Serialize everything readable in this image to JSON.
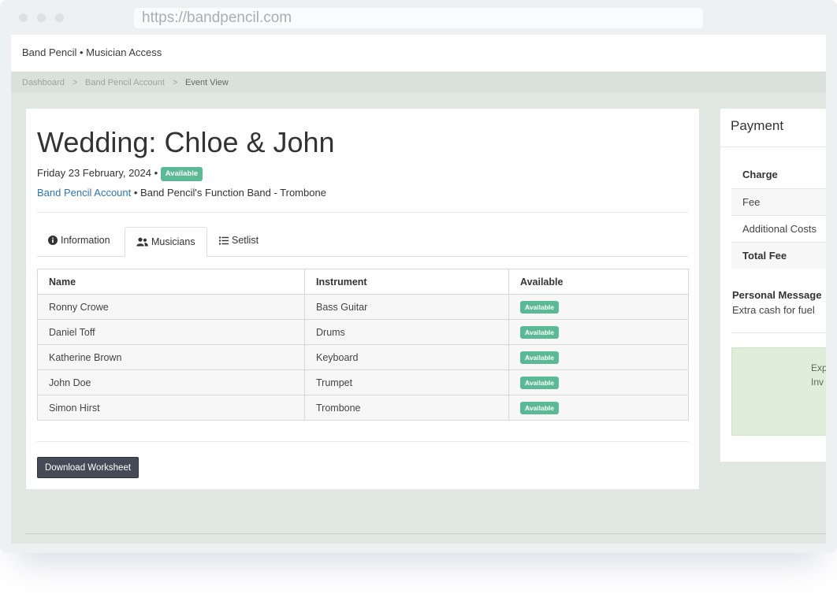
{
  "browser": {
    "url": "https://bandpencil.com"
  },
  "nav": {
    "brand": "Band Pencil • Musician Access"
  },
  "breadcrumb": {
    "items": [
      "Dashboard",
      "Band Pencil Account",
      "Event View"
    ],
    "separator": ">"
  },
  "event": {
    "title": "Wedding: Chloe & John",
    "date": "Friday 23 February, 2024 •",
    "status": "Available",
    "account_link": "Band Pencil Account",
    "band_role": "• Band Pencil's Function Band - Trombone"
  },
  "tabs": [
    {
      "label": "Information",
      "icon": "info-circle-icon"
    },
    {
      "label": "Musicians",
      "icon": "users-icon",
      "active": true
    },
    {
      "label": "Setlist",
      "icon": "list-icon"
    }
  ],
  "musicians_table": {
    "columns": [
      "Name",
      "Instrument",
      "Available"
    ],
    "rows": [
      {
        "name": "Ronny Crowe",
        "instrument": "Bass Guitar",
        "available": "Available"
      },
      {
        "name": "Daniel Toff",
        "instrument": "Drums",
        "available": "Available"
      },
      {
        "name": "Katherine Brown",
        "instrument": "Keyboard",
        "available": "Available"
      },
      {
        "name": "John Doe",
        "instrument": "Trumpet",
        "available": "Available"
      },
      {
        "name": "Simon Hirst",
        "instrument": "Trombone",
        "available": "Available"
      }
    ]
  },
  "actions": {
    "download_worksheet": "Download Worksheet"
  },
  "payment": {
    "title": "Payment",
    "rows": [
      "Charge",
      "Fee",
      "Additional Costs",
      "Total Fee"
    ],
    "personal_message_label": "Personal Message",
    "personal_message": "Extra cash for fuel",
    "notice_lines": [
      "Exp",
      "Inv"
    ]
  },
  "colors": {
    "badge_green": "#5cb995",
    "link_blue": "#2d76b2",
    "page_bg": "#e0e7e2",
    "button_dark": "#444b57",
    "notice_green": "#dfeedb"
  }
}
